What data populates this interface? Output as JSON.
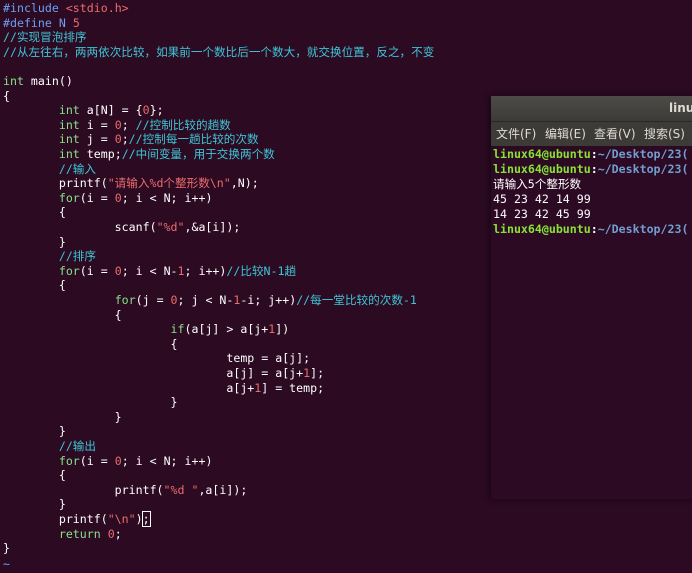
{
  "editor": {
    "lines": [
      [
        [
          "pre",
          "#include "
        ],
        [
          "str",
          "<stdio.h>"
        ]
      ],
      [
        [
          "pre",
          "#define N "
        ],
        [
          "num",
          "5"
        ]
      ],
      [
        [
          "com",
          "//实现冒泡排序"
        ]
      ],
      [
        [
          "com",
          "//从左往右，两两依次比较，如果前一个数比后一个数大，就交换位置，反之，不变"
        ]
      ],
      [],
      [
        [
          "kw",
          "int"
        ],
        [
          "txt",
          " main()"
        ]
      ],
      [
        [
          "txt",
          "{"
        ]
      ],
      [
        [
          "txt",
          "        "
        ],
        [
          "kw",
          "int"
        ],
        [
          "txt",
          " a[N] = {"
        ],
        [
          "num",
          "0"
        ],
        [
          "txt",
          "};"
        ]
      ],
      [
        [
          "txt",
          "        "
        ],
        [
          "kw",
          "int"
        ],
        [
          "txt",
          " i = "
        ],
        [
          "num",
          "0"
        ],
        [
          "txt",
          "; "
        ],
        [
          "com",
          "//控制比较的趟数"
        ]
      ],
      [
        [
          "txt",
          "        "
        ],
        [
          "kw",
          "int"
        ],
        [
          "txt",
          " j = "
        ],
        [
          "num",
          "0"
        ],
        [
          "txt",
          ";"
        ],
        [
          "com",
          "//控制每一趟比较的次数"
        ]
      ],
      [
        [
          "txt",
          "        "
        ],
        [
          "kw",
          "int"
        ],
        [
          "txt",
          " temp;"
        ],
        [
          "com",
          "//中间变量，用于交换两个数"
        ]
      ],
      [
        [
          "txt",
          "        "
        ],
        [
          "com",
          "//输入"
        ]
      ],
      [
        [
          "txt",
          "        printf("
        ],
        [
          "str",
          "\"请输入%d个整形数\\n\""
        ],
        [
          "txt",
          ",N);"
        ]
      ],
      [
        [
          "txt",
          "        "
        ],
        [
          "kw",
          "for"
        ],
        [
          "txt",
          "(i = "
        ],
        [
          "num",
          "0"
        ],
        [
          "txt",
          "; i < N; i++)"
        ]
      ],
      [
        [
          "txt",
          "        {"
        ]
      ],
      [
        [
          "txt",
          "                scanf("
        ],
        [
          "str",
          "\"%d\""
        ],
        [
          "txt",
          ",&a[i]);"
        ]
      ],
      [
        [
          "txt",
          "        }"
        ]
      ],
      [
        [
          "txt",
          "        "
        ],
        [
          "com",
          "//排序"
        ]
      ],
      [
        [
          "txt",
          "        "
        ],
        [
          "kw",
          "for"
        ],
        [
          "txt",
          "(i = "
        ],
        [
          "num",
          "0"
        ],
        [
          "txt",
          "; i < N-"
        ],
        [
          "num",
          "1"
        ],
        [
          "txt",
          "; i++)"
        ],
        [
          "com",
          "//比较N-1趟"
        ]
      ],
      [
        [
          "txt",
          "        {"
        ]
      ],
      [
        [
          "txt",
          "                "
        ],
        [
          "kw",
          "for"
        ],
        [
          "txt",
          "(j = "
        ],
        [
          "num",
          "0"
        ],
        [
          "txt",
          "; j < N-"
        ],
        [
          "num",
          "1"
        ],
        [
          "txt",
          "-i; j++)"
        ],
        [
          "com",
          "//每一堂比较的次数-1"
        ]
      ],
      [
        [
          "txt",
          "                {"
        ]
      ],
      [
        [
          "txt",
          "                        "
        ],
        [
          "kw",
          "if"
        ],
        [
          "txt",
          "(a[j] > a[j+"
        ],
        [
          "num",
          "1"
        ],
        [
          "txt",
          "])"
        ]
      ],
      [
        [
          "txt",
          "                        {"
        ]
      ],
      [
        [
          "txt",
          "                                temp = a[j];"
        ]
      ],
      [
        [
          "txt",
          "                                a[j] = a[j+"
        ],
        [
          "num",
          "1"
        ],
        [
          "txt",
          "];"
        ]
      ],
      [
        [
          "txt",
          "                                a[j+"
        ],
        [
          "num",
          "1"
        ],
        [
          "txt",
          "] = temp;"
        ]
      ],
      [
        [
          "txt",
          "                        }"
        ]
      ],
      [
        [
          "txt",
          "                }"
        ]
      ],
      [
        [
          "txt",
          "        }"
        ]
      ],
      [
        [
          "txt",
          "        "
        ],
        [
          "com",
          "//输出"
        ]
      ],
      [
        [
          "txt",
          "        "
        ],
        [
          "kw",
          "for"
        ],
        [
          "txt",
          "(i = "
        ],
        [
          "num",
          "0"
        ],
        [
          "txt",
          "; i < N; i++)"
        ]
      ],
      [
        [
          "txt",
          "        {"
        ]
      ],
      [
        [
          "txt",
          "                printf("
        ],
        [
          "str",
          "\"%d \""
        ],
        [
          "txt",
          ",a[i]);"
        ]
      ],
      [
        [
          "txt",
          "        }"
        ]
      ],
      [
        [
          "txt",
          "        printf("
        ],
        [
          "str",
          "\"\\n\""
        ],
        [
          "txt",
          ")"
        ],
        [
          "cursor",
          ";"
        ]
      ],
      [
        [
          "txt",
          "        "
        ],
        [
          "kw",
          "return"
        ],
        [
          "txt",
          " "
        ],
        [
          "num",
          "0"
        ],
        [
          "txt",
          ";"
        ]
      ],
      [
        [
          "txt",
          "}"
        ]
      ]
    ],
    "tilde": "~"
  },
  "terminal": {
    "title": "linu",
    "menu": [
      "文件(F)",
      "编辑(E)",
      "查看(V)",
      "搜索(S)"
    ],
    "lines": [
      {
        "user": "linux64@ubuntu",
        "sep": ":",
        "path": "~/Desktop/23("
      },
      {
        "user": "linux64@ubuntu",
        "sep": ":",
        "path": "~/Desktop/23("
      },
      {
        "text": "请输入5个整形数"
      },
      {
        "text": "45 23 42 14 99"
      },
      {
        "text": "14 23 42 45 99"
      },
      {
        "user": "linux64@ubuntu",
        "sep": ":",
        "path": "~/Desktop/23("
      }
    ]
  }
}
